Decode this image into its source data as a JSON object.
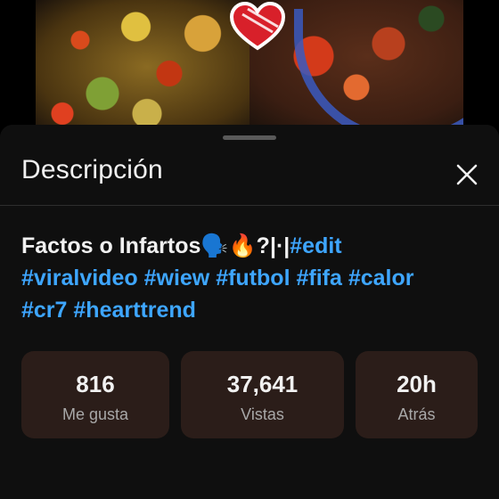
{
  "video": {
    "thumbnail": "food-video-thumbnail",
    "overlay_icon": "heart-sticker-icon"
  },
  "sheet": {
    "title": "Descripción",
    "close_icon": "close-icon"
  },
  "description": {
    "text": "Factos o Infartos🗣️🔥?|·|",
    "hashtags": [
      "#edit",
      "#viralvideo",
      "#wiew",
      "#futbol",
      "#fifa",
      "#calor",
      "#cr7",
      "#hearttrend"
    ]
  },
  "stats": [
    {
      "value": "816",
      "label": "Me gusta"
    },
    {
      "value": "37,641",
      "label": "Vistas"
    },
    {
      "value": "20h",
      "label": "Atrás"
    }
  ],
  "colors": {
    "background": "#0f0f0f",
    "hashtag": "#3ea6ff",
    "stat_card": "#2b1d19",
    "text_primary": "#f1f1f1",
    "text_secondary": "#a8a8a8"
  }
}
